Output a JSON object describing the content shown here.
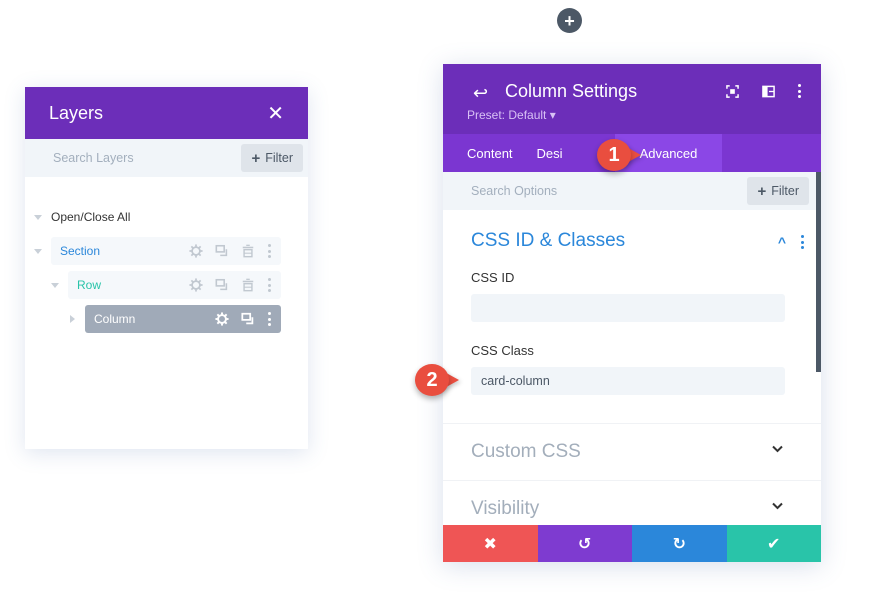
{
  "top_add": {
    "icon": "plus-icon",
    "label": "+"
  },
  "layers": {
    "title": "Layers",
    "close_icon": "close-icon",
    "close_glyph": "✕",
    "search_placeholder": "Search Layers",
    "filter_label": "Filter",
    "filter_glyph": "+",
    "open_close_all": "Open/Close All",
    "items": [
      {
        "name": "Section",
        "color": "#2b87da",
        "icons": [
          "gear-icon",
          "duplicate-icon",
          "trash-icon",
          "more-icon"
        ]
      },
      {
        "name": "Row",
        "color": "#29c4a9",
        "icons": [
          "gear-icon",
          "duplicate-icon",
          "trash-icon",
          "more-icon"
        ]
      },
      {
        "name": "Column",
        "color": "#ffffff",
        "bg": "#a0aab8",
        "icons": [
          "gear-icon",
          "duplicate-icon",
          "more-icon"
        ]
      }
    ]
  },
  "settings": {
    "back_glyph": "↩",
    "title": "Column Settings",
    "preset": "Preset: Default ▾",
    "header_icons": [
      "fullscreen-icon",
      "split-view-icon",
      "more-icon"
    ],
    "tabs": [
      {
        "label": "Content",
        "active": false
      },
      {
        "label": "Desi",
        "active": false
      },
      {
        "label": "Advanced",
        "active": true
      }
    ],
    "search_placeholder": "Search Options",
    "filter_label": "Filter",
    "filter_glyph": "+",
    "section_title": "CSS ID & Classes",
    "section_collapse_glyph": "^",
    "fields": [
      {
        "label": "CSS ID",
        "value": ""
      },
      {
        "label": "CSS Class",
        "value": "card-column"
      }
    ],
    "collapsed_sections": [
      {
        "title": "Custom CSS",
        "chevron": "⌄"
      },
      {
        "title": "Visibility",
        "chevron": "⌄"
      }
    ],
    "footer": [
      {
        "name": "discard",
        "glyph": "✖",
        "color": "#ef5555"
      },
      {
        "name": "undo",
        "glyph": "↺",
        "color": "#7e3bd0"
      },
      {
        "name": "redo",
        "glyph": "↻",
        "color": "#2b87da"
      },
      {
        "name": "save",
        "glyph": "✔",
        "color": "#29c4a9"
      }
    ]
  },
  "callouts": [
    {
      "number": "1",
      "color": "#e94e3f"
    },
    {
      "number": "2",
      "color": "#e94e3f"
    }
  ]
}
